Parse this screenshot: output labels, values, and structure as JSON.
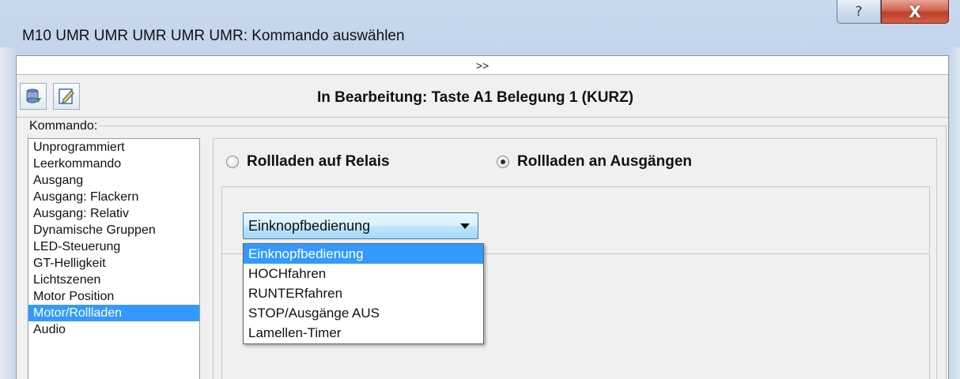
{
  "window": {
    "title": "M10 UMR UMR UMR UMR UMR: Kommando auswählen",
    "help_glyph": "?",
    "close_glyph": "X"
  },
  "expand_bar": {
    "label": ">>"
  },
  "toolbar": {
    "heading": "In Bearbeitung: Taste A1 Belegung 1 (KURZ)"
  },
  "command_group": {
    "label": "Kommando:",
    "items": [
      "Unprogrammiert",
      "Leerkommando",
      "Ausgang",
      "Ausgang: Flackern",
      "Ausgang: Relativ",
      "Dynamische Gruppen",
      "LED-Steuerung",
      "GT-Helligkeit",
      "Lichtszenen",
      "Motor Position",
      "Motor/Rollladen",
      "Audio"
    ],
    "selected": "Motor/Rollladen"
  },
  "mode": {
    "options": [
      "Rollladen auf Relais",
      "Rollladen an Ausgängen"
    ],
    "selected": "Rollladen an Ausgängen"
  },
  "combo": {
    "value": "Einknopfbedienung",
    "options": [
      "Einknopfbedienung",
      "HOCHfahren",
      "RUNTERfahren",
      "STOP/Ausgänge AUS",
      "Lamellen-Timer"
    ],
    "highlighted": "Einknopfbedienung"
  }
}
